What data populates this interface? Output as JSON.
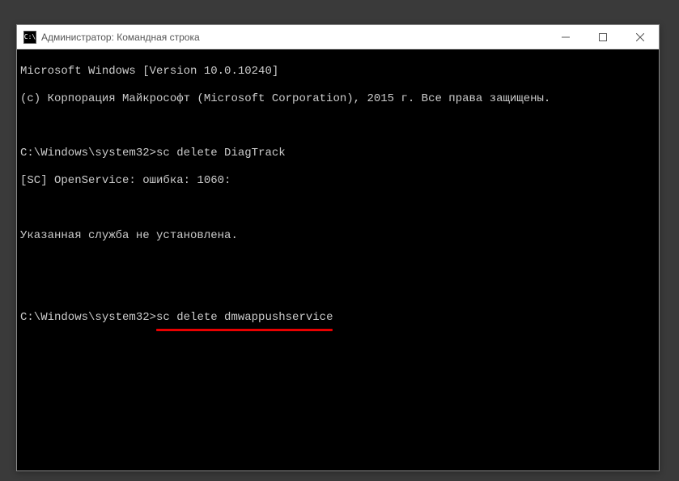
{
  "titlebar": {
    "icon_label": "C:\\",
    "title": "Администратор: Командная строка"
  },
  "console": {
    "line1": "Microsoft Windows [Version 10.0.10240]",
    "line2": "(c) Корпорация Майкрософт (Microsoft Corporation), 2015 г. Все права защищены.",
    "prompt1": "C:\\Windows\\system32>",
    "cmd1": "sc delete DiagTrack",
    "result1": "[SC] OpenService: ошибка: 1060:",
    "result2": "Указанная служба не установлена.",
    "prompt2": "C:\\Windows\\system32>",
    "cmd2": "sc delete dmwappushservice"
  }
}
